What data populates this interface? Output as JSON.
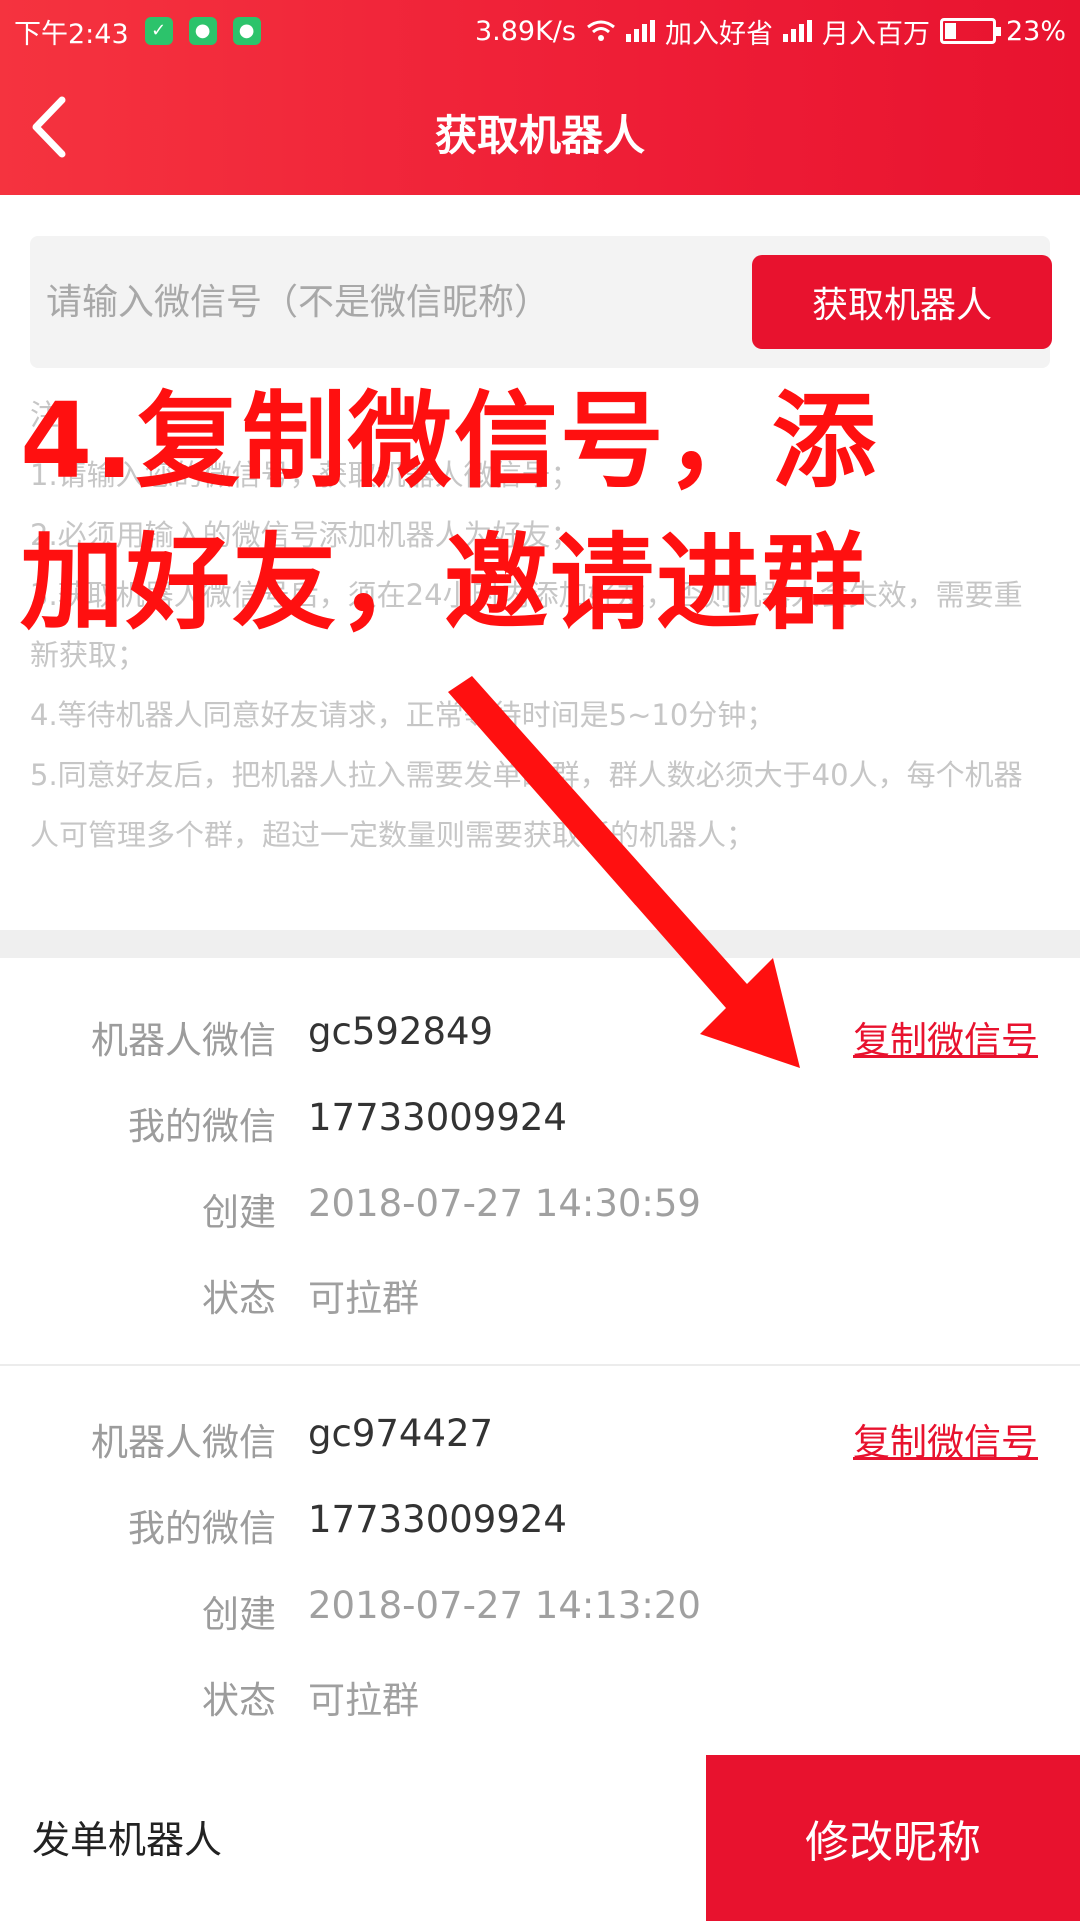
{
  "status_bar": {
    "time": "下午2:43",
    "speed": "3.89K/s",
    "carrier1": "加入好省",
    "carrier2": "月入百万",
    "battery": "23%",
    "battery_level": 0.23
  },
  "header": {
    "title": "获取机器人"
  },
  "search": {
    "placeholder": "请输入微信号（不是微信昵称）",
    "button_label": "获取机器人"
  },
  "notes": [
    "注：",
    "1.请输入您的微信号，获取机器人微信号；",
    "2.必须用输入的微信号添加机器人为好友；",
    "3.获取机器人微信号后，须在24小时内添加好友，否则机器人会失效，需要重新获取；",
    "4.等待机器人同意好友请求，正常等待时间是5~10分钟；",
    "5.同意好友后，把机器人拉入需要发单的群，群人数必须大于40人，每个机器人可管理多个群，超过一定数量则需要获取新的机器人；"
  ],
  "overlay": {
    "line1": "4.复制微信号，添",
    "line2": "加好友，邀请进群"
  },
  "robots": [
    {
      "robot_label": "机器人微信",
      "robot_wechat": "gc592849",
      "copy_label": "复制微信号",
      "my_label": "我的微信",
      "my_wechat": "17733009924",
      "created_label": "创建",
      "created": "2018-07-27 14:30:59",
      "status_label": "状态",
      "status": "可拉群"
    },
    {
      "robot_label": "机器人微信",
      "robot_wechat": "gc974427",
      "copy_label": "复制微信号",
      "my_label": "我的微信",
      "my_wechat": "17733009924",
      "created_label": "创建",
      "created": "2018-07-27 14:13:20",
      "status_label": "状态",
      "status": "可拉群"
    }
  ],
  "bottom": {
    "label": "发单机器人",
    "button": "修改昵称"
  },
  "colors": {
    "brand_red": "#e8122e",
    "overlay_red": "#ff1010"
  }
}
